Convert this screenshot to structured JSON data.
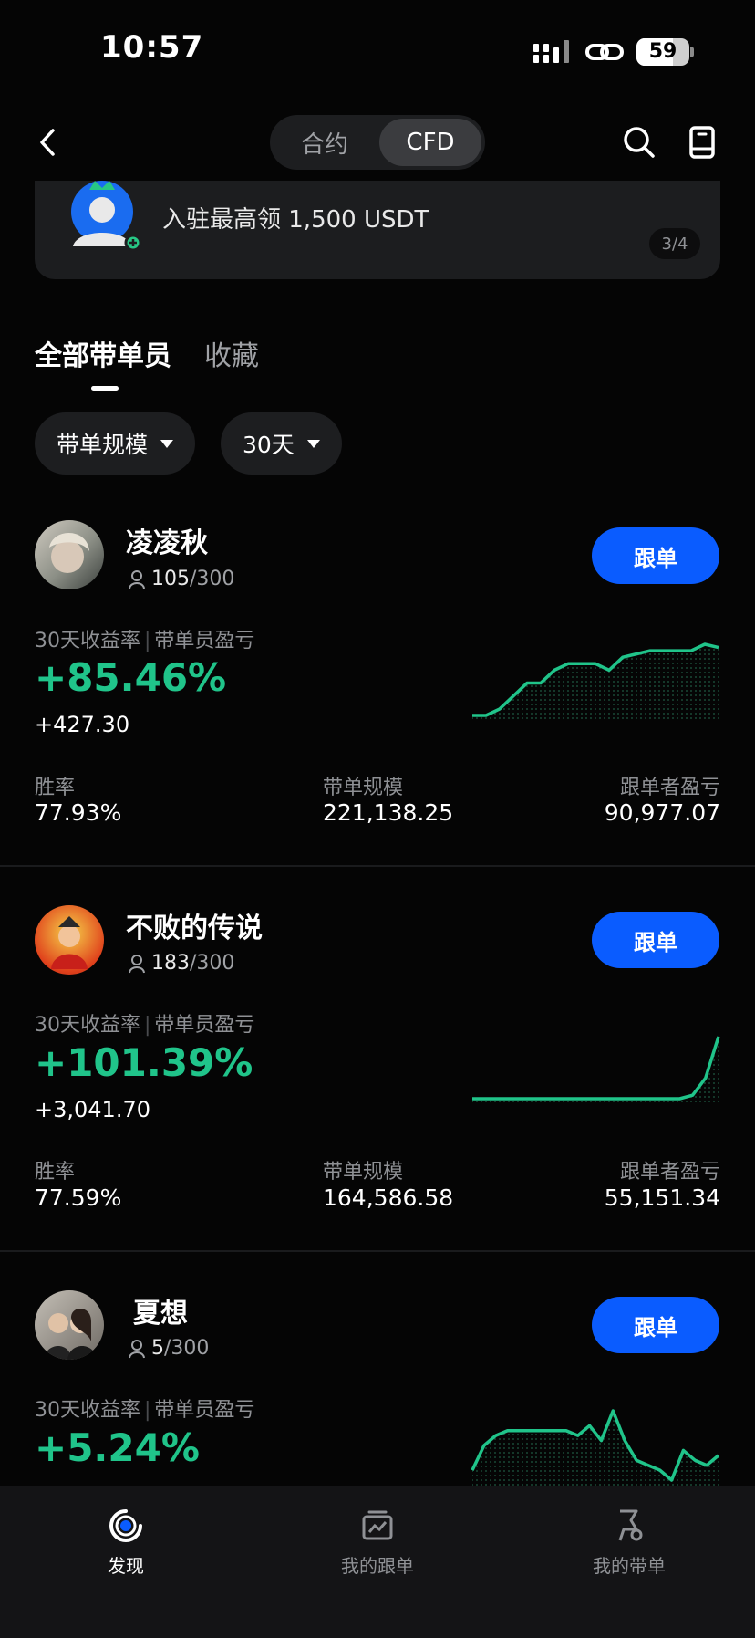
{
  "status_bar": {
    "time": "10:57",
    "battery": "59"
  },
  "header": {
    "segments": [
      "合约",
      "CFD"
    ],
    "active_segment": "CFD"
  },
  "banner": {
    "text": "入驻最高领 1,500 USDT",
    "pager": "3/4"
  },
  "tabs": [
    "全部带单员",
    "收藏"
  ],
  "filters": [
    {
      "label": "带单规模"
    },
    {
      "label": "30天"
    }
  ],
  "metric_label_roi": "30天收益率",
  "metric_label_pnl": "带单员盈亏",
  "stat_labels": [
    "胜率",
    "带单规模",
    "跟单者盈亏"
  ],
  "follow_label": "跟单",
  "traders": [
    {
      "name": "凌凌秋",
      "followers": "105",
      "capacity": "/300",
      "roi": "+85.46%",
      "pnl": "+427.30",
      "win_rate": "77.93%",
      "aum": "221,138.25",
      "follower_pnl": "90,977.07",
      "spark": [
        0,
        0,
        2,
        6,
        10,
        10,
        14,
        16,
        16,
        16,
        14,
        18,
        19,
        20,
        20,
        20,
        20,
        22,
        21
      ]
    },
    {
      "name": "不败的传说",
      "followers": "183",
      "capacity": "/300",
      "roi": "+101.39%",
      "pnl": "+3,041.70",
      "win_rate": "77.59%",
      "aum": "164,586.58",
      "follower_pnl": "55,151.34",
      "spark": [
        0,
        0,
        0,
        0,
        0,
        0,
        0,
        0,
        0,
        0,
        0,
        0,
        0,
        0,
        0,
        0,
        0,
        1,
        6,
        18
      ]
    },
    {
      "name": "夏想",
      "followers": "5",
      "capacity": "/300",
      "roi": "+5.24%",
      "spark": [
        0,
        5,
        7,
        8,
        8,
        8,
        8,
        8,
        8,
        7,
        9,
        6,
        12,
        6,
        2,
        1,
        0,
        -2,
        4,
        2,
        1,
        3
      ]
    }
  ],
  "bottom_nav": [
    "发现",
    "我的跟单",
    "我的带单"
  ],
  "colors": {
    "accent": "#0a5cff",
    "positive": "#20c48a",
    "background": "#050505"
  }
}
